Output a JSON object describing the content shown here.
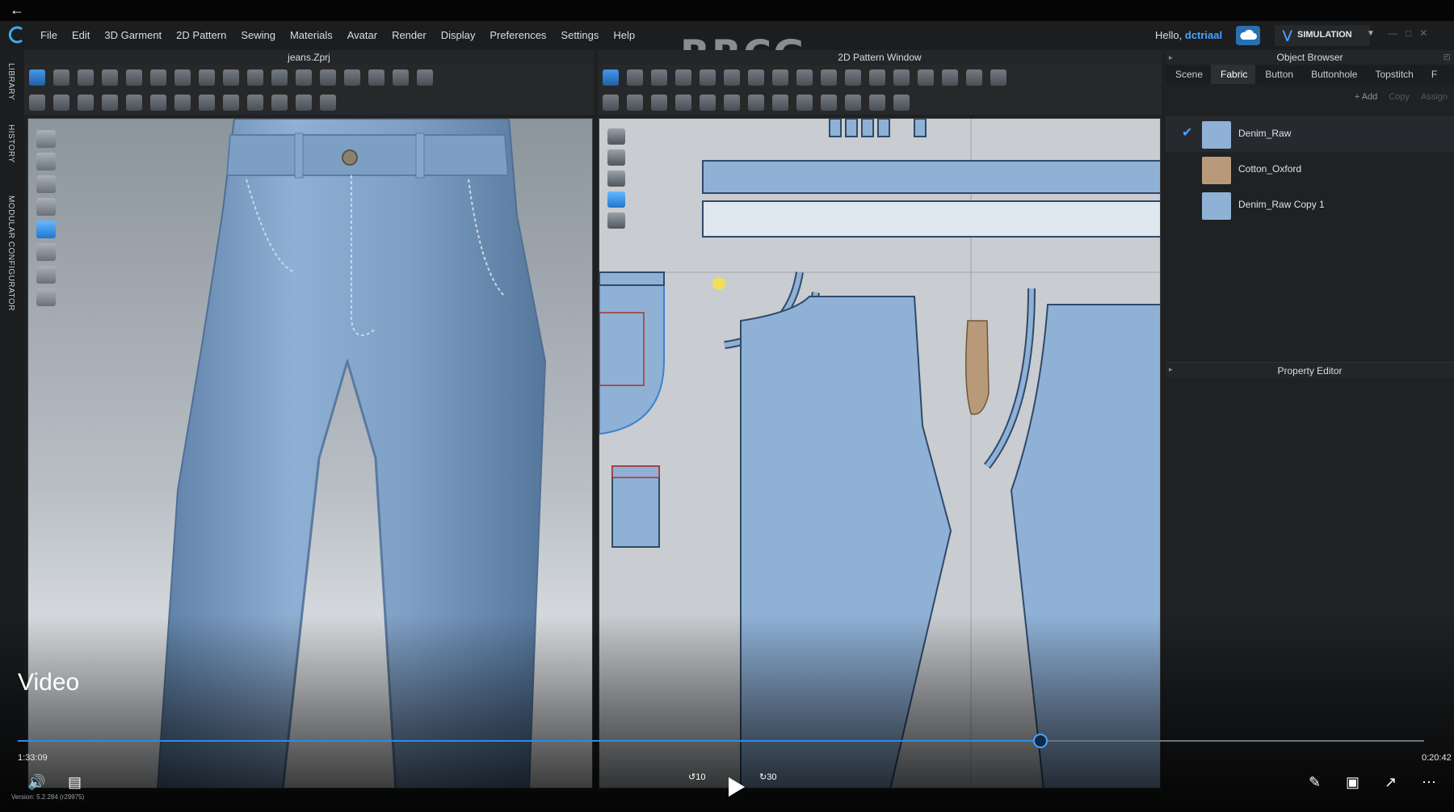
{
  "menubar": {
    "items": [
      "File",
      "Edit",
      "3D Garment",
      "2D Pattern",
      "Sewing",
      "Materials",
      "Avatar",
      "Render",
      "Display",
      "Preferences",
      "Settings",
      "Help"
    ],
    "watermark": "RRCG",
    "hello": "Hello,",
    "username": "dctriaal",
    "simulation_label": "SIMULATION"
  },
  "window3d": {
    "title": "jeans.Zprj"
  },
  "window2d": {
    "title": "2D Pattern Window"
  },
  "side_tabs": [
    "LIBRARY",
    "HISTORY",
    "MODULAR CONFIGURATOR"
  ],
  "object_browser": {
    "title": "Object Browser",
    "tabs": [
      "Scene",
      "Fabric",
      "Button",
      "Buttonhole",
      "Topstitch",
      "F"
    ],
    "active_tab": "Fabric",
    "actions": [
      "+ Add",
      "Copy",
      "Assign"
    ],
    "fabrics": [
      {
        "name": "Denim_Raw",
        "color": "#8fb1d6",
        "checked": true
      },
      {
        "name": "Cotton_Oxford",
        "color": "#b89a7a",
        "checked": false
      },
      {
        "name": "Denim_Raw Copy 1",
        "color": "#8fb1d6",
        "checked": false
      }
    ]
  },
  "property_editor": {
    "title": "Property Editor"
  },
  "video": {
    "label": "Video",
    "elapsed": "1:33:09",
    "remaining": "0:20:42",
    "progress_fraction": 0.727,
    "skip_back": "10",
    "skip_forward": "30",
    "version": "Version: 5.2.284 (r29975)"
  }
}
